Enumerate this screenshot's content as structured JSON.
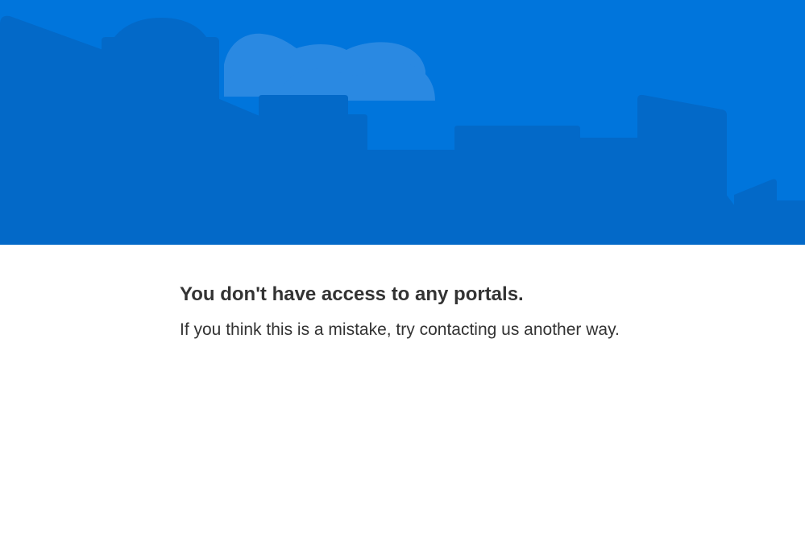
{
  "colors": {
    "hero_background": "#0075DC",
    "hero_buildings": "#0369C8",
    "hero_clouds": "#2A89E2",
    "text": "#333333",
    "page_background": "#FFFFFF"
  },
  "hero": {
    "illustration": "city-skyline-icon"
  },
  "error": {
    "title": "You don't have access to any portals.",
    "message": "If you think this is a mistake, try contacting us another way."
  }
}
